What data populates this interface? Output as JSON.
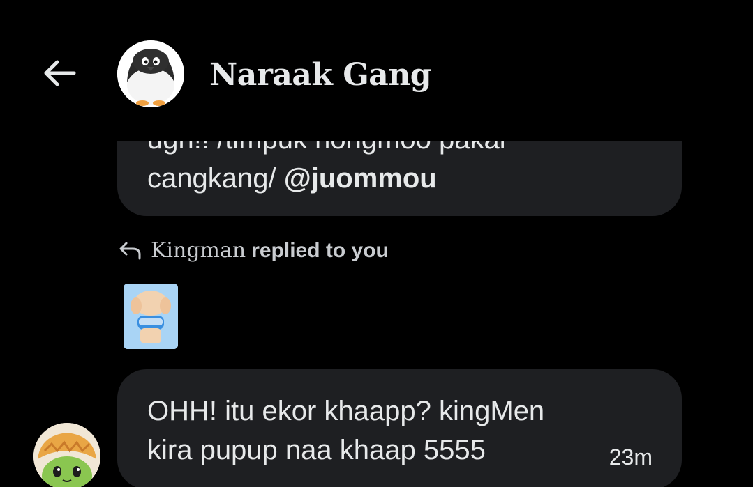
{
  "header": {
    "title": "Naraak Gang",
    "avatar_icon": "penguin-avatar-icon",
    "back_icon": "arrow-left-icon"
  },
  "messages": {
    "previous": {
      "text_partial": "ugh!! /timpuk nongmoo pakai",
      "text_visible": "cangkang/ ",
      "mention": "@juommou"
    },
    "reply": {
      "name": "Kingman",
      "label": "replied to you",
      "icon": "reply-arrow-icon",
      "thumb_icon": "sticker-thumbnail-icon"
    },
    "current": {
      "line1": "OHH! itu ekor khaapp? kingMen",
      "line2": "kira pupup naa khaap 5555",
      "time": "23m",
      "sender_avatar_icon": "frog-avatar-icon"
    }
  },
  "colors": {
    "background": "#000000",
    "bubble": "#1e1f22",
    "text": "#e7e9ea",
    "muted": "#c9ccd0"
  }
}
